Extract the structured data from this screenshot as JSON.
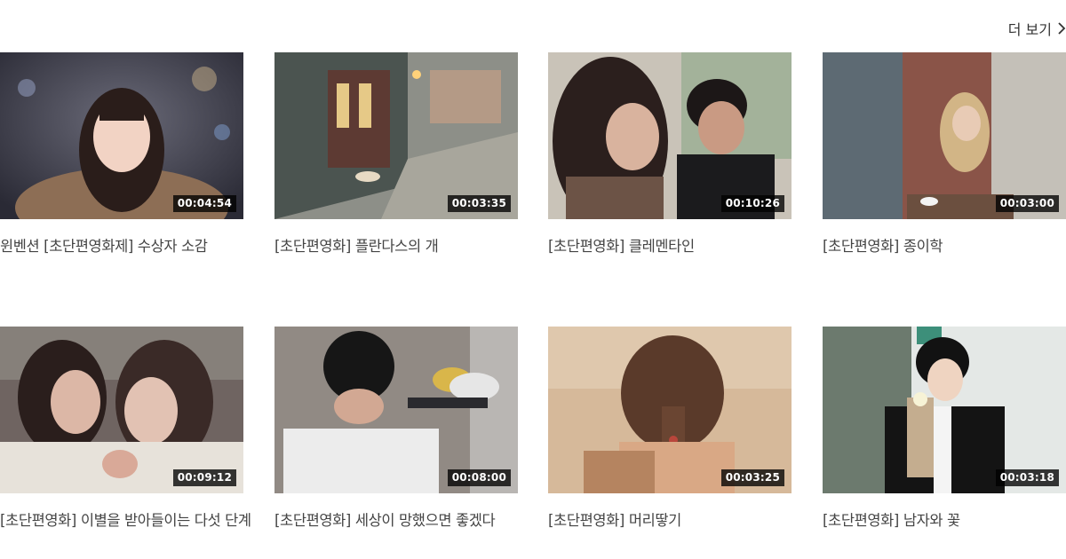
{
  "header": {
    "more_label": "더 보기",
    "more_icon": "chevron-right-icon"
  },
  "videos": [
    {
      "title": "윈벤션 [초단편영화제] 수상자 소감",
      "duration": "00:04:54"
    },
    {
      "title": "[초단편영화] 플란다스의 개",
      "duration": "00:03:35"
    },
    {
      "title": "[초단편영화] 클레멘타인",
      "duration": "00:10:26"
    },
    {
      "title": "[초단편영화] 종이학",
      "duration": "00:03:00"
    },
    {
      "title": "[초단편영화] 이별을 받아들이는 다섯 단계",
      "duration": "00:09:12"
    },
    {
      "title": "[초단편영화] 세상이 망했으면 좋겠다",
      "duration": "00:08:00"
    },
    {
      "title": "[초단편영화] 머리땋기",
      "duration": "00:03:25"
    },
    {
      "title": "[초단편영화] 남자와 꽃",
      "duration": "00:03:18"
    }
  ]
}
